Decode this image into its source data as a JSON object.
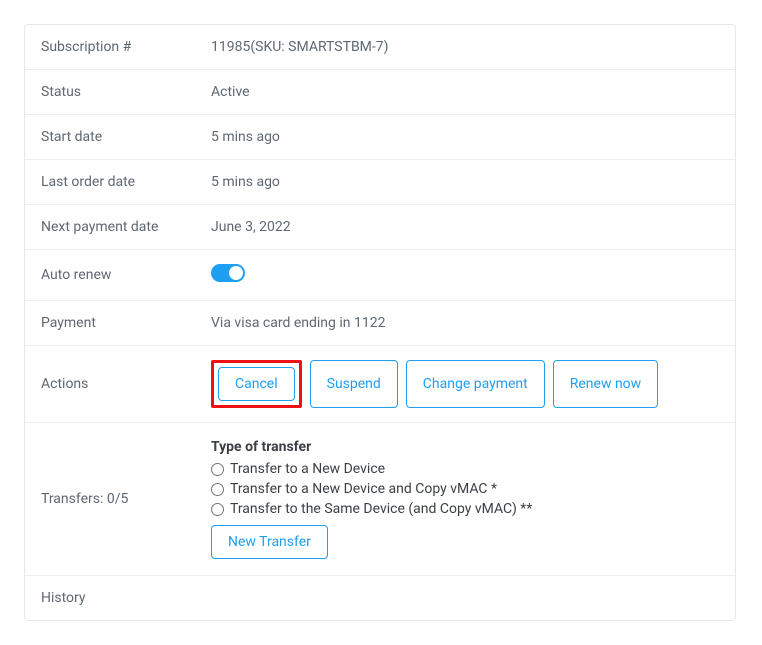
{
  "rows": {
    "subscription_label": "Subscription #",
    "subscription_value": "11985(SKU: SMARTSTBM-7)",
    "status_label": "Status",
    "status_value": "Active",
    "start_label": "Start date",
    "start_value": "5 mins ago",
    "last_order_label": "Last order date",
    "last_order_value": "5 mins ago",
    "next_payment_label": "Next payment date",
    "next_payment_value": "June 3, 2022",
    "auto_renew_label": "Auto renew",
    "payment_label": "Payment",
    "payment_value": "Via visa card ending in 1122",
    "actions_label": "Actions",
    "transfers_label": "Transfers: 0/5",
    "history_label": "History"
  },
  "actions": {
    "cancel": "Cancel",
    "suspend": "Suspend",
    "change_payment": "Change payment",
    "renew_now": "Renew now"
  },
  "transfer": {
    "heading": "Type of transfer",
    "opt1": "Transfer to a New Device",
    "opt2": "Transfer to a New Device and Copy vMAC *",
    "opt3": "Transfer to the Same Device (and Copy vMAC) **",
    "button": "New Transfer"
  }
}
